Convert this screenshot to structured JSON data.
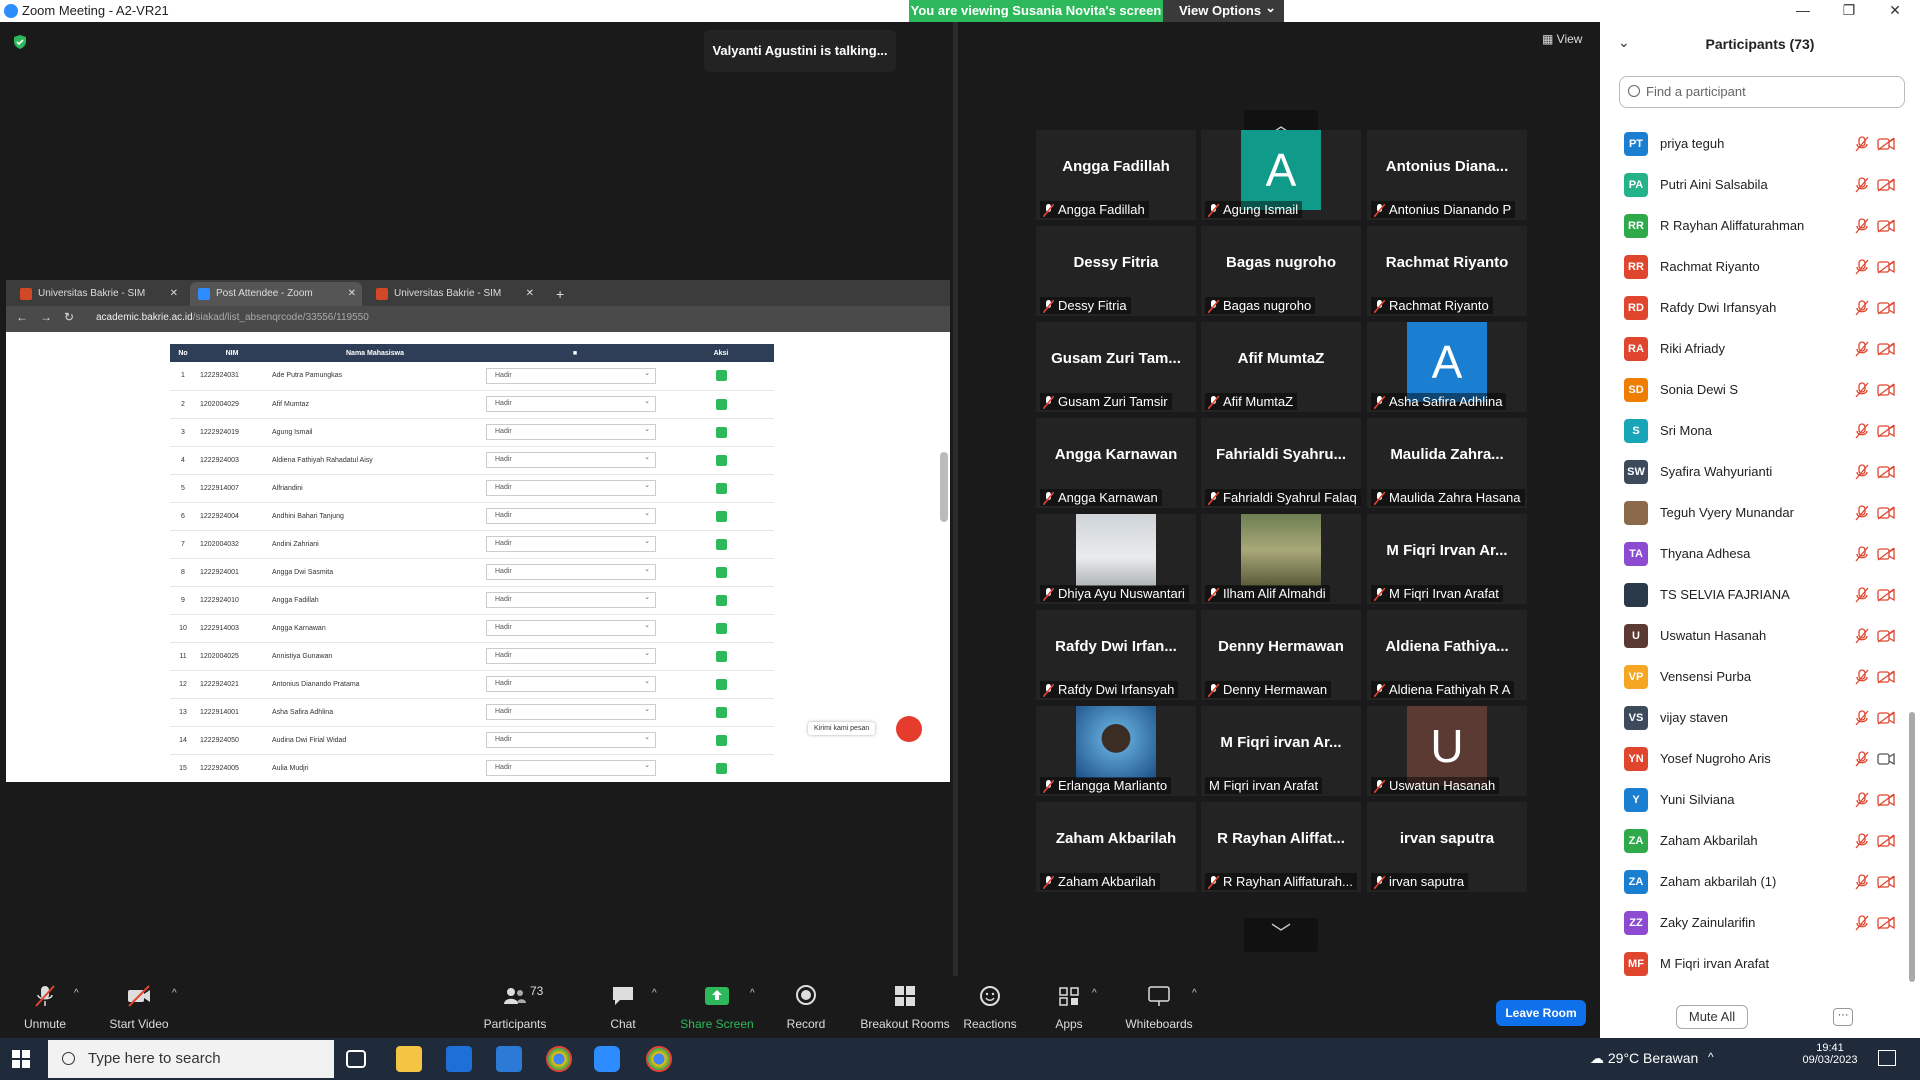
{
  "window": {
    "title": "Zoom Meeting - A2-VR21",
    "minimize_glyph": "—",
    "maximize_glyph": "❐",
    "close_glyph": "✕"
  },
  "share_banner": {
    "text": "You are viewing Susania Novita's screen",
    "view_options": "View Options",
    "view_options_caret": "⌄"
  },
  "talking_indicator": "Valyanti Agustini is talking...",
  "view_button": "View",
  "shared_screen": {
    "tabs": [
      {
        "label": "Universitas Bakrie - SIM Akadem",
        "color": "#d24726",
        "close": "✕"
      },
      {
        "label": "Post Attendee - Zoom",
        "color": "#2d8cff",
        "close": "✕"
      },
      {
        "label": "Universitas Bakrie - SIM Akadem",
        "color": "#d24726",
        "close": "✕"
      }
    ],
    "new_tab": "+",
    "url_domain": "academic.bakrie.ac.id",
    "url_path": "/siakad/list_absenqrcode/33556/119550",
    "table_headers": [
      "No",
      "NIM",
      "Nama Mahasiswa",
      "■",
      "Aksi"
    ],
    "rows": [
      {
        "no": "1",
        "nim": "1222924031",
        "name": "Ade Putra Pamungkas",
        "status": "Hadir"
      },
      {
        "no": "2",
        "nim": "1202004029",
        "name": "Afif Mumtaz",
        "status": "Hadir"
      },
      {
        "no": "3",
        "nim": "1222924019",
        "name": "Agung Ismail",
        "status": "Hadir"
      },
      {
        "no": "4",
        "nim": "1222924003",
        "name": "Aldiena Fathiyah Rahadatul Aisy",
        "status": "Hadir"
      },
      {
        "no": "5",
        "nim": "1222914007",
        "name": "Alfriandini",
        "status": "Hadir"
      },
      {
        "no": "6",
        "nim": "1222924004",
        "name": "Andhini Bahari Tanjung",
        "status": "Hadir"
      },
      {
        "no": "7",
        "nim": "1202004032",
        "name": "Andini Zahriani",
        "status": "Hadir"
      },
      {
        "no": "8",
        "nim": "1222924001",
        "name": "Angga Dwi Sasmita",
        "status": "Hadir"
      },
      {
        "no": "9",
        "nim": "1222924010",
        "name": "Angga Fadillah",
        "status": "Hadir"
      },
      {
        "no": "10",
        "nim": "1222914003",
        "name": "Angga Karnawan",
        "status": "Hadir"
      },
      {
        "no": "11",
        "nim": "1202004025",
        "name": "Annistiya Gunawan",
        "status": "Hadir"
      },
      {
        "no": "12",
        "nim": "1222924021",
        "name": "Antonius Dianando Pratama",
        "status": "Hadir"
      },
      {
        "no": "13",
        "nim": "1222914001",
        "name": "Asha Safira Adhlina",
        "status": "Hadir"
      },
      {
        "no": "14",
        "nim": "1222924050",
        "name": "Audina Dwi Firial Widad",
        "status": "Hadir"
      },
      {
        "no": "15",
        "nim": "1222924005",
        "name": "Aulia Mudjri",
        "status": "Hadir"
      }
    ],
    "chat_widget": "Kirimi kami pesan"
  },
  "gallery": {
    "up_arrow": "︿",
    "down_arrow": "﹀",
    "tiles": [
      {
        "big": "Angga Fadillah",
        "name": "Angga Fadillah",
        "avatar": "",
        "avatar_color": "",
        "photo": ""
      },
      {
        "big": "",
        "name": "Agung Ismail",
        "avatar": "A",
        "avatar_color": "#0f9a8a",
        "photo": ""
      },
      {
        "big": "Antonius  Diana...",
        "name": "Antonius Dianando P",
        "avatar": "",
        "avatar_color": "",
        "photo": ""
      },
      {
        "big": "Dessy Fitria",
        "name": "Dessy Fitria",
        "avatar": "",
        "avatar_color": "",
        "photo": ""
      },
      {
        "big": "Bagas nugroho",
        "name": "Bagas nugroho",
        "avatar": "",
        "avatar_color": "",
        "photo": ""
      },
      {
        "big": "Rachmat Riyanto",
        "name": "Rachmat Riyanto",
        "avatar": "",
        "avatar_color": "",
        "photo": ""
      },
      {
        "big": "Gusam Zuri Tam...",
        "name": "Gusam Zuri Tamsir",
        "avatar": "",
        "avatar_color": "",
        "photo": ""
      },
      {
        "big": "Afif MumtaZ",
        "name": "Afif MumtaZ",
        "avatar": "",
        "avatar_color": "",
        "photo": ""
      },
      {
        "big": "",
        "name": "Asha Safira Adhlina",
        "avatar": "A",
        "avatar_color": "#1a7fd1",
        "photo": ""
      },
      {
        "big": "Angga Karnawan",
        "name": "Angga Karnawan",
        "avatar": "",
        "avatar_color": "",
        "photo": ""
      },
      {
        "big": "Fahrialdi  Syahru...",
        "name": "Fahrialdi Syahrul Falaq",
        "avatar": "",
        "avatar_color": "",
        "photo": ""
      },
      {
        "big": "Maulida  Zahra...",
        "name": "Maulida Zahra Hasana",
        "avatar": "",
        "avatar_color": "",
        "photo": ""
      },
      {
        "big": "",
        "name": "Dhiya Ayu Nuswantari",
        "avatar": "",
        "avatar_color": "",
        "photo": "snow"
      },
      {
        "big": "",
        "name": "Ilham Alif Almahdi",
        "avatar": "",
        "avatar_color": "",
        "photo": "tree"
      },
      {
        "big": "M Fiqri Irvan Ar...",
        "name": "M Fiqri Irvan Arafat",
        "avatar": "",
        "avatar_color": "",
        "photo": ""
      },
      {
        "big": "Rafdy Dwi Irfan...",
        "name": "Rafdy Dwi Irfansyah",
        "avatar": "",
        "avatar_color": "",
        "photo": ""
      },
      {
        "big": "Denny Hermawan",
        "name": "Denny Hermawan",
        "avatar": "",
        "avatar_color": "",
        "photo": ""
      },
      {
        "big": "Aldiena  Fathiya...",
        "name": "Aldiena Fathiyah R A",
        "avatar": "",
        "avatar_color": "",
        "photo": ""
      },
      {
        "big": "",
        "name": "Erlangga Marlianto",
        "avatar": "",
        "avatar_color": "",
        "photo": "face"
      },
      {
        "big": "M Fiqri irvan Ar...",
        "name": "M Fiqri irvan Arafat",
        "avatar": "",
        "avatar_color": "",
        "photo": ""
      },
      {
        "big": "",
        "name": "Uswatun Hasanah",
        "avatar": "U",
        "avatar_color": "#5a3a32",
        "photo": ""
      },
      {
        "big": "Zaham Akbarilah",
        "name": "Zaham Akbarilah",
        "avatar": "",
        "avatar_color": "",
        "photo": ""
      },
      {
        "big": "R Rayhan Aliffat...",
        "name": "R Rayhan Aliffaturah...",
        "avatar": "",
        "avatar_color": "",
        "photo": ""
      },
      {
        "big": "irvan saputra",
        "name": "irvan saputra",
        "avatar": "",
        "avatar_color": "",
        "photo": ""
      }
    ]
  },
  "participants_panel": {
    "title": "Participants (73)",
    "collapse_glyph": "⌄",
    "search_placeholder": "Find a participant",
    "participants": [
      {
        "initials": "PT",
        "name": "priya teguh",
        "color": "#1a7fd1",
        "mic": "muted",
        "cam": "off"
      },
      {
        "initials": "PA",
        "name": "Putri Aini Salsabila",
        "color": "#23b28a",
        "mic": "muted",
        "cam": "off"
      },
      {
        "initials": "RR",
        "name": "R Rayhan Aliffaturahman",
        "color": "#2eaa4a",
        "mic": "muted",
        "cam": "off"
      },
      {
        "initials": "RR",
        "name": "Rachmat Riyanto",
        "color": "#e0452e",
        "mic": "muted",
        "cam": "off"
      },
      {
        "initials": "RD",
        "name": "Rafdy Dwi Irfansyah",
        "color": "#e0452e",
        "mic": "muted",
        "cam": "off"
      },
      {
        "initials": "RA",
        "name": "Riki Afriady",
        "color": "#e0452e",
        "mic": "muted",
        "cam": "off"
      },
      {
        "initials": "SD",
        "name": "Sonia Dewi S",
        "color": "#ef7d00",
        "mic": "muted",
        "cam": "off"
      },
      {
        "initials": "S",
        "name": "Sri Mona",
        "color": "#18a5b8",
        "mic": "muted",
        "cam": "off"
      },
      {
        "initials": "SW",
        "name": "Syafira Wahyurianti",
        "color": "#3d4a5c",
        "mic": "muted",
        "cam": "off"
      },
      {
        "initials": "",
        "name": "Teguh Vyery Munandar",
        "color": "#8a6a4a",
        "mic": "muted",
        "cam": "off"
      },
      {
        "initials": "TA",
        "name": "Thyana Adhesa",
        "color": "#8c4bd0",
        "mic": "muted",
        "cam": "off"
      },
      {
        "initials": "",
        "name": "TS SELVIA FAJRIANA",
        "color": "#2a3a4a",
        "mic": "muted",
        "cam": "off"
      },
      {
        "initials": "U",
        "name": "Uswatun Hasanah",
        "color": "#5a3a32",
        "mic": "muted",
        "cam": "off"
      },
      {
        "initials": "VP",
        "name": "Vensensi Purba",
        "color": "#f5a623",
        "mic": "muted",
        "cam": "off"
      },
      {
        "initials": "VS",
        "name": "vijay staven",
        "color": "#3d4a5c",
        "mic": "muted",
        "cam": "off"
      },
      {
        "initials": "YN",
        "name": "Yosef Nugroho Aris",
        "color": "#e0452e",
        "mic": "muted",
        "cam": "on"
      },
      {
        "initials": "Y",
        "name": "Yuni Silviana",
        "color": "#1a7fd1",
        "mic": "muted",
        "cam": "off"
      },
      {
        "initials": "ZA",
        "name": "Zaham Akbarilah",
        "color": "#2eaa4a",
        "mic": "muted",
        "cam": "off"
      },
      {
        "initials": "ZA",
        "name": "Zaham akbarilah (1)",
        "color": "#1a7fd1",
        "mic": "muted",
        "cam": "off"
      },
      {
        "initials": "ZZ",
        "name": "Zaky Zainularifin",
        "color": "#8c4bd0",
        "mic": "muted",
        "cam": "off"
      },
      {
        "initials": "MF",
        "name": "M Fiqri irvan Arafat",
        "color": "#e0452e",
        "mic": "",
        "cam": ""
      }
    ],
    "mute_all": "Mute All",
    "more": "···"
  },
  "toolbar": {
    "unmute": "Unmute",
    "start_video": "Start Video",
    "participants": "Participants",
    "participants_count": "73",
    "chat": "Chat",
    "share_screen": "Share Screen",
    "record": "Record",
    "breakout_rooms": "Breakout Rooms",
    "reactions": "Reactions",
    "apps": "Apps",
    "whiteboards": "Whiteboards",
    "leave_room": "Leave Room",
    "caret": "^"
  },
  "taskbar": {
    "search_placeholder": "Type here to search",
    "weather": "29°C  Berawan",
    "time": "19:41",
    "date": "09/03/2023",
    "tray_caret": "^"
  },
  "colors": {
    "accent": "#0e71eb",
    "share_green": "#2eb85c",
    "muted_red": "#e0452e"
  }
}
